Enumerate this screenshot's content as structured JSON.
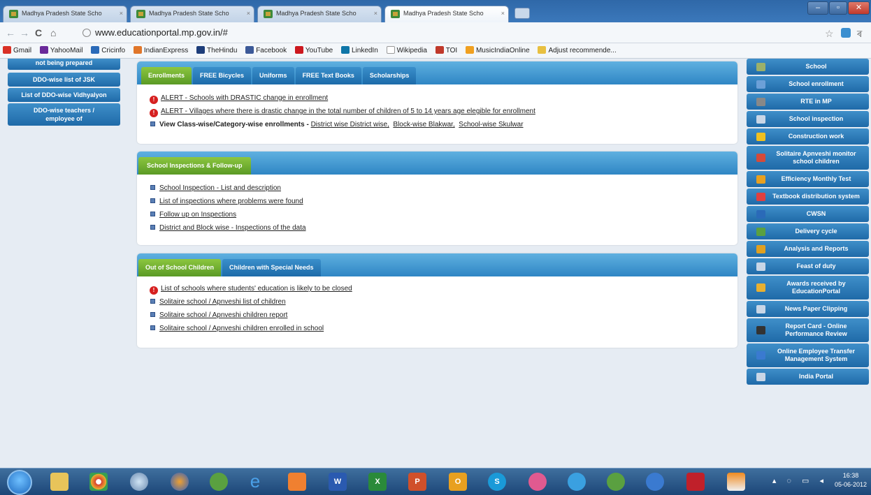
{
  "browser": {
    "tabs": [
      {
        "title": "Madhya Pradesh State Scho"
      },
      {
        "title": "Madhya Pradesh State Scho"
      },
      {
        "title": "Madhya Pradesh State Scho"
      },
      {
        "title": "Madhya Pradesh State Scho"
      }
    ],
    "url": "www.educationportal.mp.gov.in/#",
    "bookmarks": [
      "Gmail",
      "YahooMail",
      "Cricinfo",
      "IndianExpress",
      "TheHindu",
      "Facebook",
      "YouTube",
      "LinkedIn",
      "Wikipedia",
      "TOI",
      "MusicIndiaOnline",
      "Adjust recommende..."
    ]
  },
  "left_nav": [
    "not being prepared",
    "DDO-wise list of JSK",
    "List of DDO-wise Vidhyalyon",
    "DDO-wise teachers / employee of"
  ],
  "right_nav": [
    {
      "label": "School",
      "icon": "school-icon",
      "color": "#9bb06a"
    },
    {
      "label": "School enrollment",
      "icon": "students-icon",
      "color": "#6ca0d8"
    },
    {
      "label": "RTE in MP",
      "icon": "rte-icon",
      "color": "#888888"
    },
    {
      "label": "School inspection",
      "icon": "inspection-icon",
      "color": "#c9d6e6"
    },
    {
      "label": "Construction work",
      "icon": "helmet-icon",
      "color": "#f0c020"
    },
    {
      "label": "Solitaire Apnveshi monitor school children",
      "icon": "children-icon",
      "color": "#d44a3a"
    },
    {
      "label": "Efficiency Monthly Test",
      "icon": "pencil-icon",
      "color": "#e8a020"
    },
    {
      "label": "Textbook distribution system",
      "icon": "books-icon",
      "color": "#e04040"
    },
    {
      "label": "CWSN",
      "icon": "wheelchair-icon",
      "color": "#2a6ab8"
    },
    {
      "label": "Delivery cycle",
      "icon": "cycle-icon",
      "color": "#5aa040"
    },
    {
      "label": "Analysis and Reports",
      "icon": "bar-chart-icon",
      "color": "#e0a020"
    },
    {
      "label": "Feast of duty",
      "icon": "feast-icon",
      "color": "#c9d6e6"
    },
    {
      "label": "Awards received by EducationPortal",
      "icon": "award-icon",
      "color": "#e8b030"
    },
    {
      "label": "News Paper Clipping",
      "icon": "newspaper-icon",
      "color": "#c9d6e6"
    },
    {
      "label": "Report Card - Online Performance Review",
      "icon": "report-card-icon",
      "color": "#333333"
    },
    {
      "label": "Online Employee Transfer Management System",
      "icon": "transfer-icon",
      "color": "#3a7ad0"
    },
    {
      "label": "India Portal",
      "icon": "india-portal-icon",
      "color": "#c9d6e6"
    }
  ],
  "panel1": {
    "tabs": [
      "Enrollments",
      "FREE Bicycles",
      "Uniforms",
      "FREE Text Books",
      "Scholarships"
    ],
    "items": [
      {
        "type": "alert",
        "text": "ALERT - Schools with DRASTIC change in enrollment"
      },
      {
        "type": "alert",
        "text": "ALERT - Villages where there is drastic change in the total number of children of 5 to 14 years age elegible for enrollment"
      }
    ],
    "view_row": {
      "label": "View Class-wise/Category-wise enrollments - ",
      "links": [
        "District wise District wise,",
        "Block-wise Blakwar,",
        "School-wise Skulwar"
      ]
    }
  },
  "panel2": {
    "tabs": [
      "School Inspections & Follow-up"
    ],
    "items": [
      "School Inspection - List and description",
      "List of inspections where problems were found",
      "Follow up on Inspections",
      "District and Block wise - Inspections of the data"
    ]
  },
  "panel3": {
    "tabs": [
      "Out of School Children",
      "Children with Special Needs"
    ],
    "alert": "List of schools where students' education is likely to be closed",
    "items": [
      "Solitaire school / Apnveshi list of children",
      "Solitaire school / Apnveshi children report",
      "Solitaire school / Apnveshi children enrolled in school"
    ]
  },
  "taskbar": {
    "time": "16:38",
    "date": "05-06-2012"
  }
}
